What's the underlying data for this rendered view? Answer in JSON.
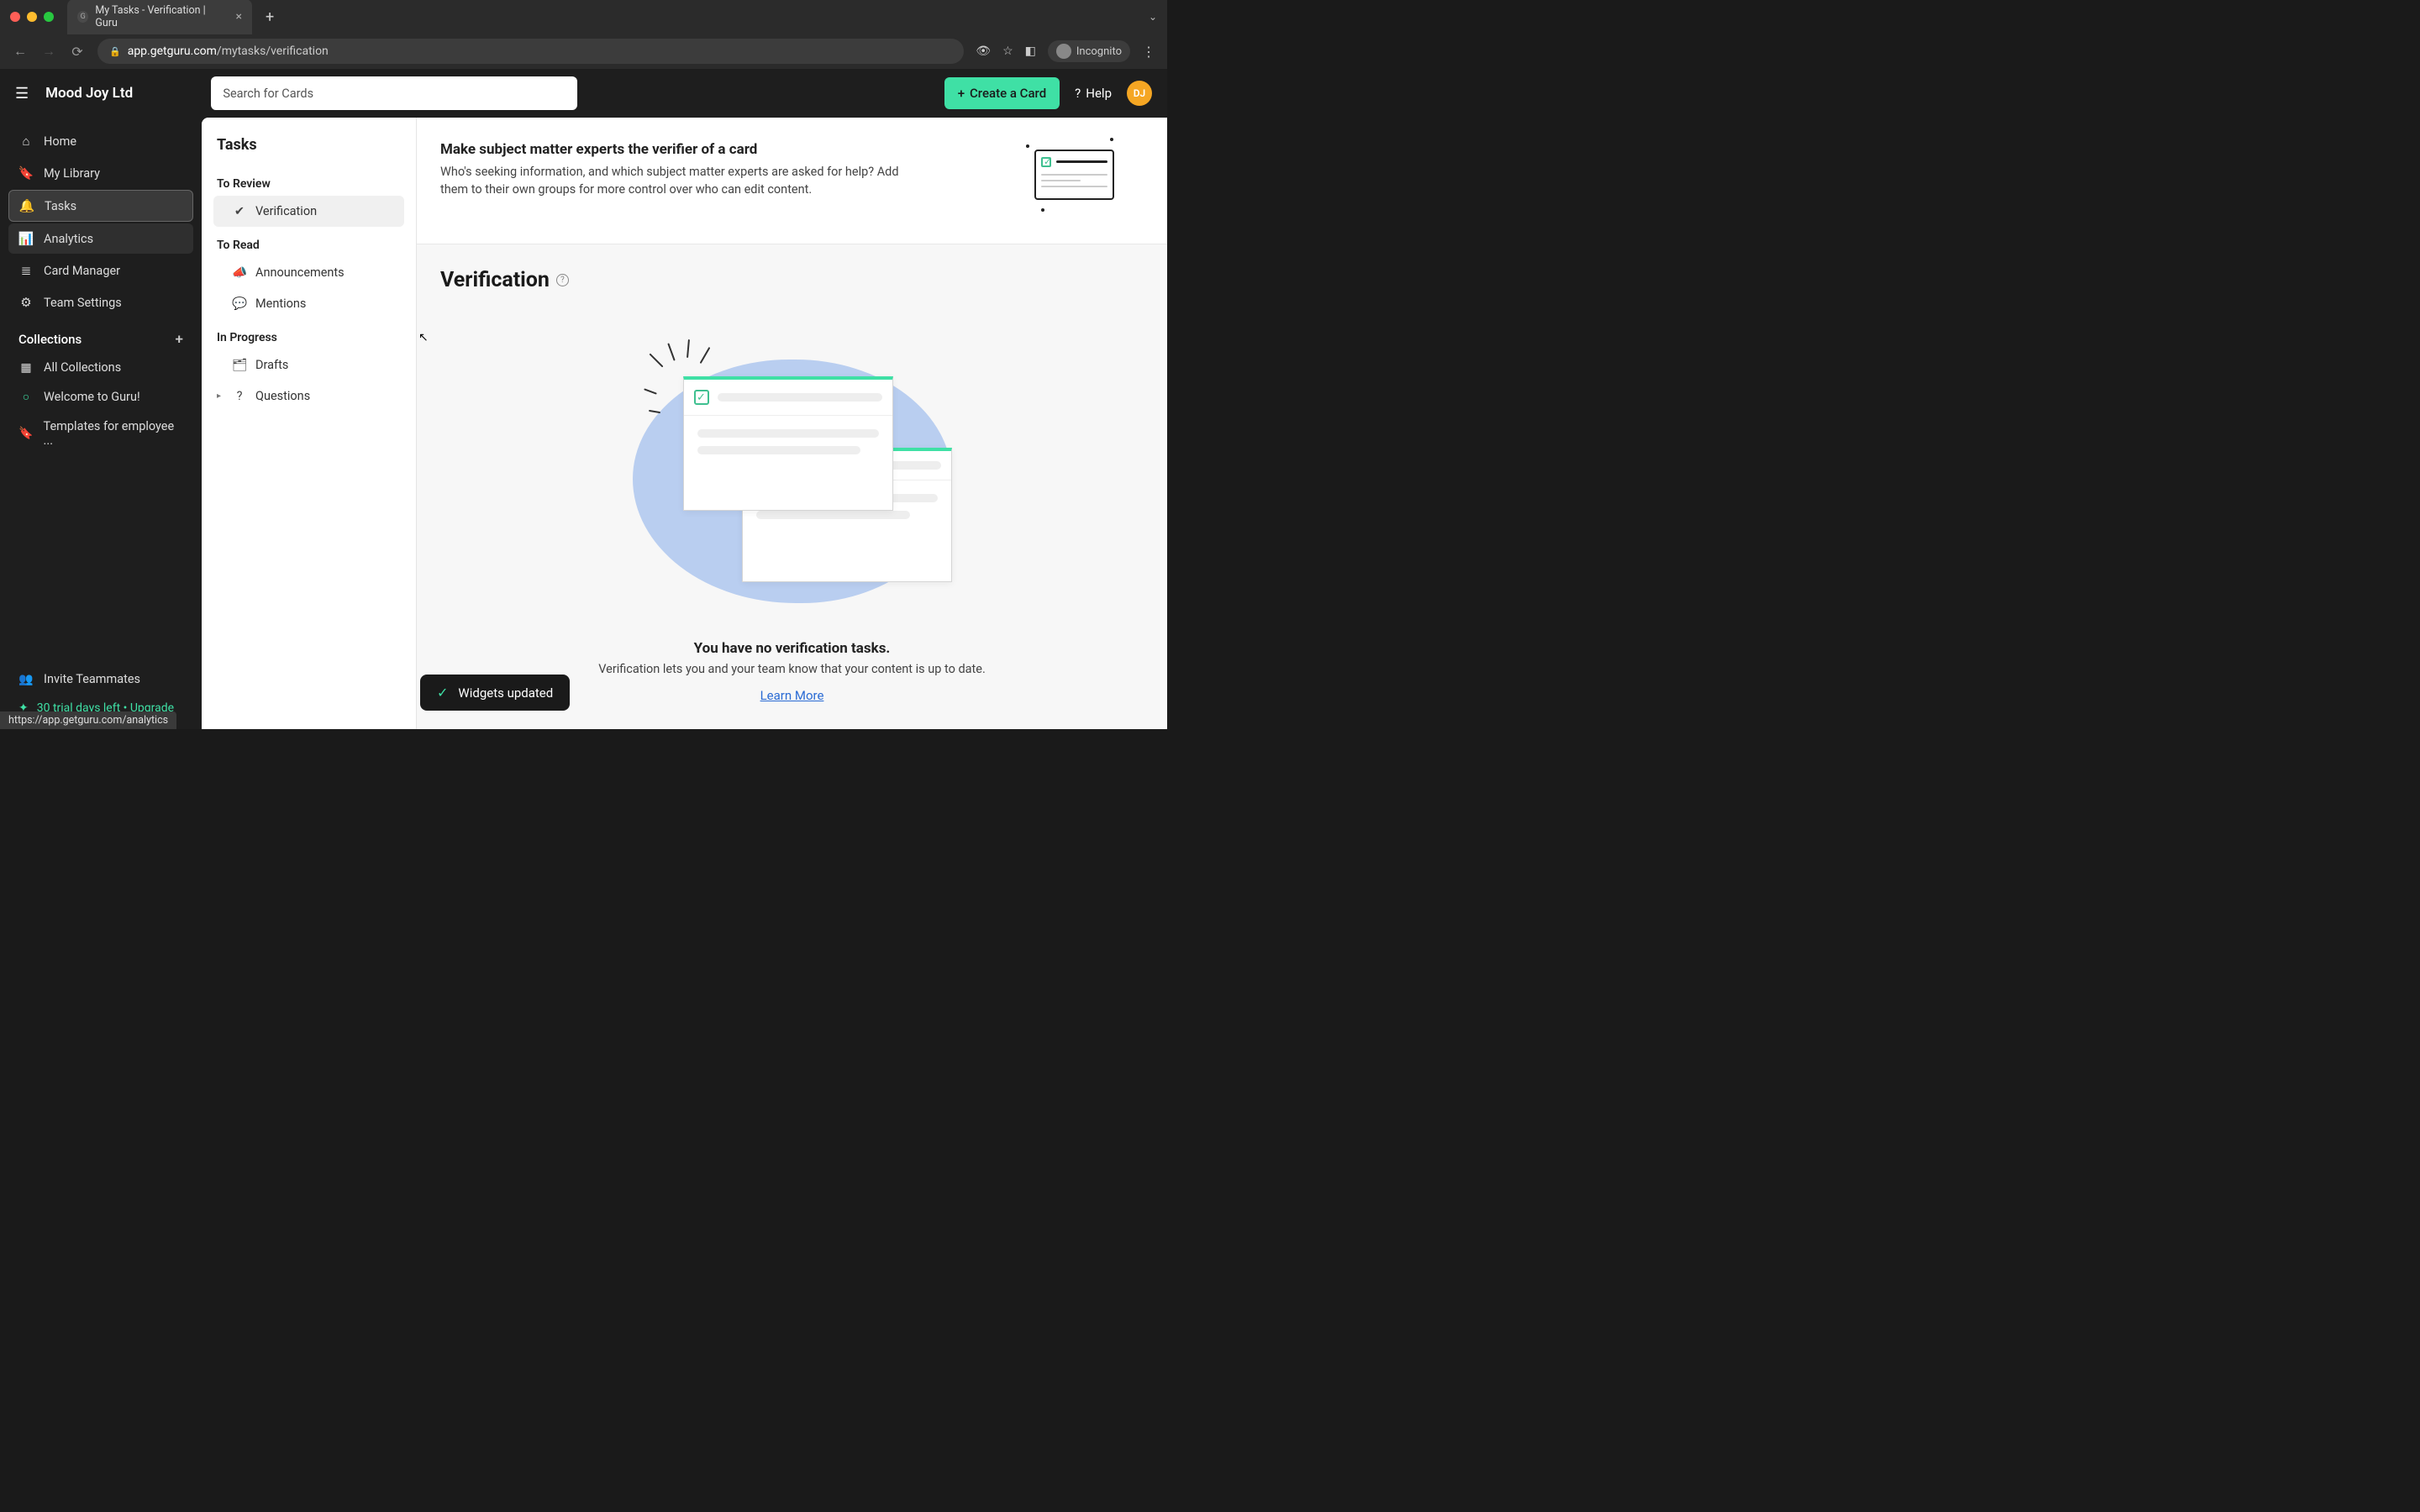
{
  "browser": {
    "tab_title": "My Tasks - Verification | Guru",
    "url_host": "app.getguru.com",
    "url_path": "/mytasks/verification",
    "incognito_label": "Incognito",
    "status_bar_url": "https://app.getguru.com/analytics"
  },
  "header": {
    "workspace": "Mood Joy Ltd",
    "search_placeholder": "Search for Cards",
    "create_card": "Create a Card",
    "help": "Help",
    "avatar_initials": "DJ"
  },
  "nav": {
    "home": "Home",
    "my_library": "My Library",
    "tasks": "Tasks",
    "analytics": "Analytics",
    "card_manager": "Card Manager",
    "team_settings": "Team Settings",
    "collections_header": "Collections",
    "all_collections": "All Collections",
    "collection_1": "Welcome to Guru!",
    "collection_2": "Templates for employee ...",
    "invite": "Invite Teammates",
    "trial": "30 trial days left • Upgrade"
  },
  "tasks_panel": {
    "title": "Tasks",
    "to_review": "To Review",
    "verification": "Verification",
    "to_read": "To Read",
    "announcements": "Announcements",
    "mentions": "Mentions",
    "in_progress": "In Progress",
    "drafts": "Drafts",
    "questions": "Questions"
  },
  "banner": {
    "title": "Make subject matter experts the verifier of a card",
    "desc": "Who's seeking information, and which subject matter experts are asked for help? Add them to their own groups for more control over who can edit content."
  },
  "main": {
    "page_title": "Verification",
    "empty_heading": "You have no verification tasks.",
    "empty_sub": "Verification lets you and your team know that your content is up to date.",
    "learn_more": "Learn More"
  },
  "toast": {
    "message": "Widgets updated"
  }
}
